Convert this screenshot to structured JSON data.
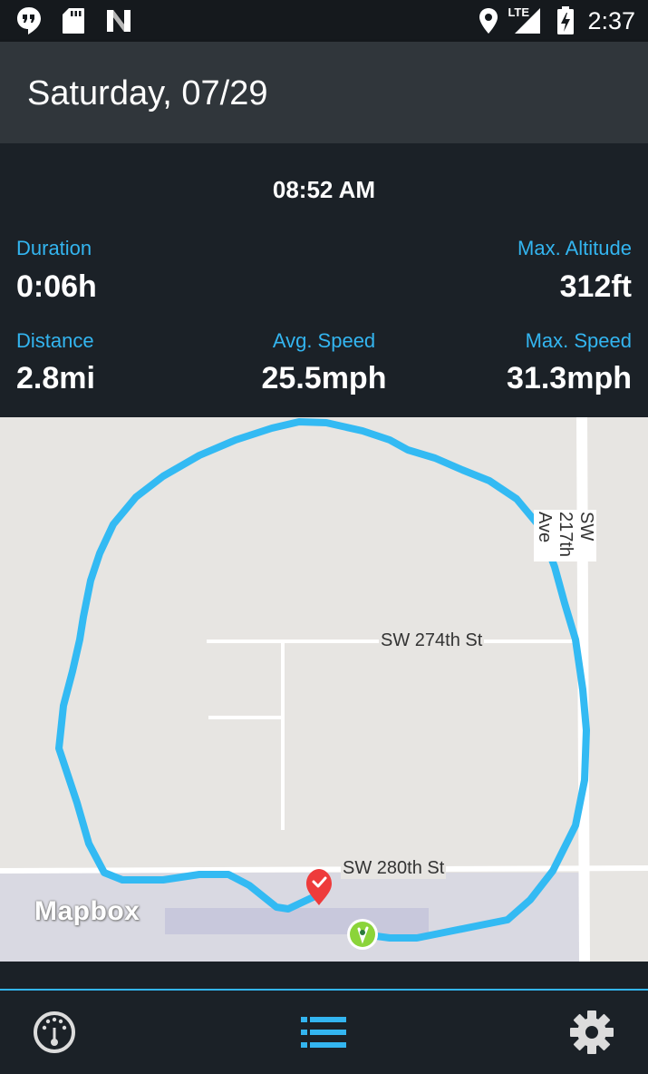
{
  "status_bar": {
    "time": "2:37",
    "network": "LTE",
    "icons": [
      "hangouts-icon",
      "sd-card-icon",
      "n-icon",
      "location-icon",
      "signal-icon",
      "battery-charging-icon"
    ]
  },
  "app_bar": {
    "title": "Saturday, 07/29"
  },
  "trip": {
    "start_time": "08:52 AM",
    "duration_label": "Duration",
    "duration_value": "0:06h",
    "max_altitude_label": "Max. Altitude",
    "max_altitude_value": "312ft",
    "distance_label": "Distance",
    "distance_value": "2.8mi",
    "avg_speed_label": "Avg. Speed",
    "avg_speed_value": "25.5mph",
    "max_speed_label": "Max. Speed",
    "max_speed_value": "31.3mph"
  },
  "map": {
    "streets": {
      "sw_274th": "SW 274th St",
      "sw_280th": "SW 280th St",
      "sw_217th": "SW 217th Ave"
    },
    "attribution": "Mapbox",
    "route_color": "#33baf3",
    "start_marker_color": "#8bd43a",
    "end_marker_color": "#ee3b3b"
  },
  "nav": {
    "items": [
      "speedometer-icon",
      "list-icon",
      "gear-icon"
    ],
    "active_color": "#33b5f0"
  }
}
